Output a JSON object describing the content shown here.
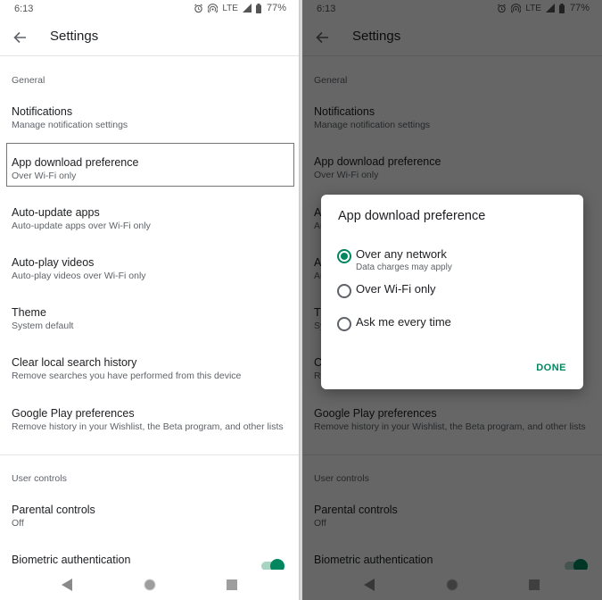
{
  "status_bar": {
    "time": "6:13",
    "network": "LTE",
    "battery": "77%",
    "icons": [
      "alarm-icon",
      "hotspot-icon",
      "signal-icon",
      "battery-icon"
    ]
  },
  "app_bar": {
    "title": "Settings",
    "back_icon": "arrow-back-icon"
  },
  "sections": {
    "general": "General",
    "user_controls": "User controls"
  },
  "items": [
    {
      "title": "Notifications",
      "subtitle": "Manage notification settings"
    },
    {
      "title": "App download preference",
      "subtitle": "Over Wi-Fi only"
    },
    {
      "title": "Auto-update apps",
      "subtitle": "Auto-update apps over Wi-Fi only"
    },
    {
      "title": "Auto-play videos",
      "subtitle": "Auto-play videos over Wi-Fi only"
    },
    {
      "title": "Theme",
      "subtitle": "System default"
    },
    {
      "title": "Clear local search history",
      "subtitle": "Remove searches you have performed from this device"
    },
    {
      "title": "Google Play preferences",
      "subtitle": "Remove history in your Wishlist, the Beta program, and other lists"
    },
    {
      "title": "Parental controls",
      "subtitle": "Off"
    },
    {
      "title": "Biometric authentication",
      "subtitle": ""
    }
  ],
  "biometric_toggle_on": true,
  "dialog": {
    "title": "App download preference",
    "options": [
      {
        "label": "Over any network",
        "sublabel": "Data charges may apply",
        "checked": true
      },
      {
        "label": "Over Wi-Fi only",
        "sublabel": "",
        "checked": false
      },
      {
        "label": "Ask me every time",
        "sublabel": "",
        "checked": false
      }
    ],
    "done_label": "DONE"
  },
  "nav_bar": {
    "icons": [
      "back-triangle-icon",
      "home-circle-icon",
      "recents-square-icon"
    ]
  },
  "colors": {
    "accent": "#01875f",
    "scrim": "rgba(0,0,0,0.6)"
  }
}
